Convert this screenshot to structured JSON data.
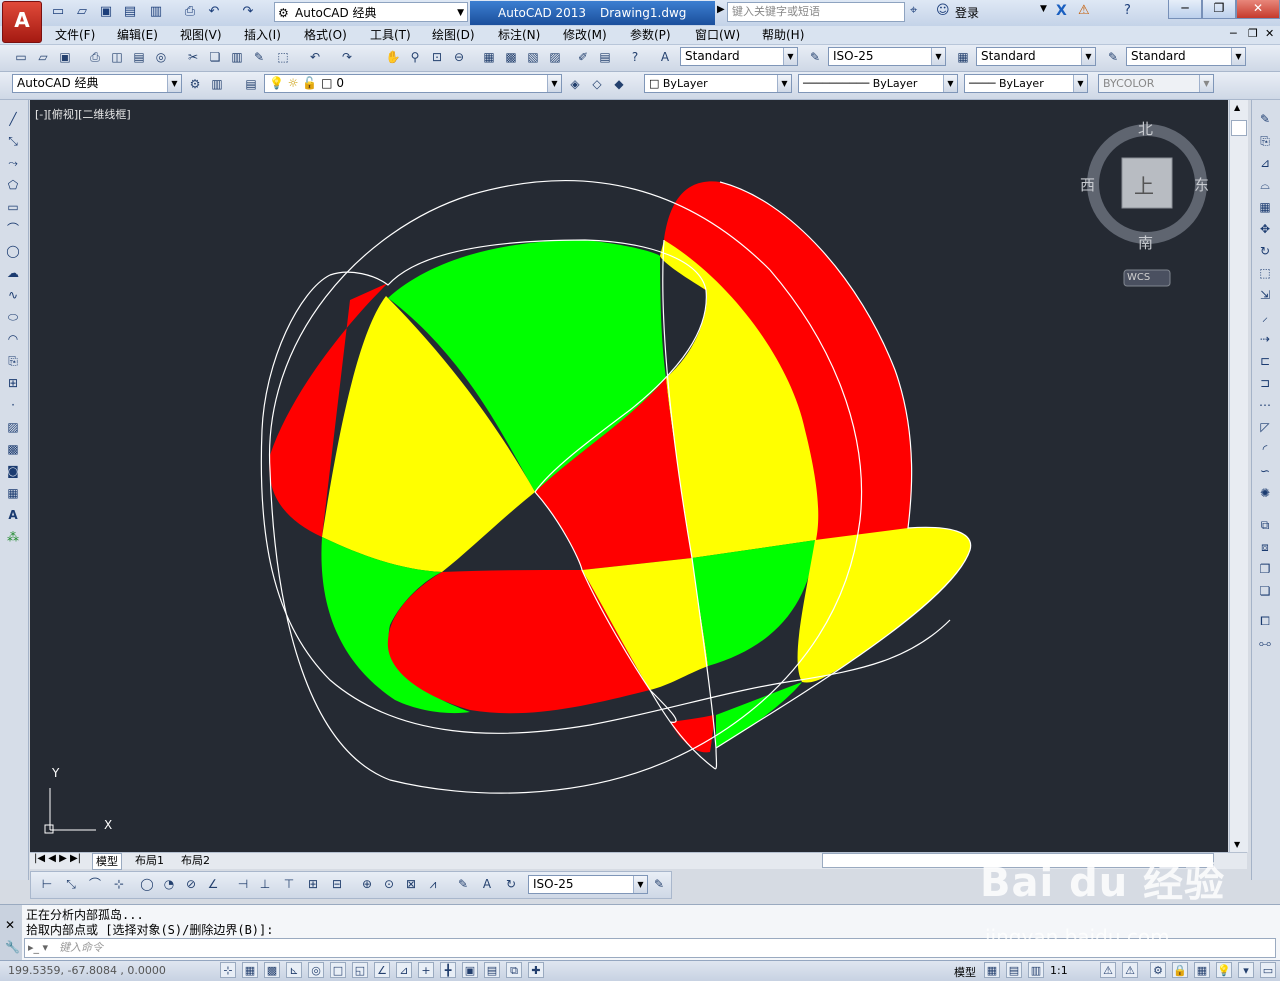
{
  "window": {
    "app_name": "AutoCAD 2013",
    "doc_name": "Drawing1.dwg",
    "workspace": "AutoCAD 经典",
    "search_placeholder": "键入关键字或短语",
    "login_label": "登录"
  },
  "menus": [
    "文件(F)",
    "编辑(E)",
    "视图(V)",
    "插入(I)",
    "格式(O)",
    "工具(T)",
    "绘图(D)",
    "标注(N)",
    "修改(M)",
    "参数(P)",
    "窗口(W)",
    "帮助(H)"
  ],
  "styles_toolbar": {
    "text_style": "Standard",
    "dim_style": "ISO-25",
    "table_style": "Standard",
    "multileader_style": "Standard"
  },
  "layers_toolbar": {
    "workspace": "AutoCAD 经典",
    "layer": "0",
    "color": "ByLayer",
    "linetype": "ByLayer",
    "lineweight": "ByLayer",
    "plotstyle": "BYCOLOR"
  },
  "viewport": {
    "label": "[-][俯视][二维线框]",
    "compass": {
      "north": "北",
      "south": "南",
      "east": "东",
      "west": "西",
      "face": "上"
    },
    "ucs_label": "WCS",
    "axis_x": "X",
    "axis_y": "Y"
  },
  "tabs": [
    "模型",
    "布局1",
    "布局2"
  ],
  "dim_toolbar": {
    "dim_style": "ISO-25"
  },
  "command": {
    "history": [
      "正在分析内部孤岛...",
      "拾取内部点或 [选择对象(S)/删除边界(B)]:"
    ],
    "input_placeholder": "键入命令"
  },
  "status": {
    "coords": "199.5359,  -67.8084 , 0.0000",
    "model_label": "模型",
    "scale_label": "1:1"
  },
  "watermark": {
    "brand": "Bai du 经验",
    "url": "jingyan.baidu.com"
  },
  "colors": {
    "red": "#ff0000",
    "yellow": "#ffff00",
    "green": "#00ff00",
    "canvas": "#252a33",
    "outline": "#ffffff"
  }
}
